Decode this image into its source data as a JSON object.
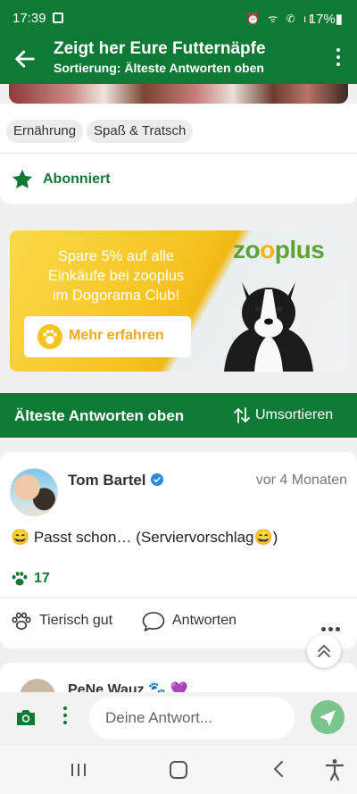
{
  "status_bar": {
    "time": "17:39",
    "icons": "⏰ ᯤ ✆ ıl",
    "battery": "17%▮"
  },
  "app_bar": {
    "title": "Zeigt her Eure Futternäpfe",
    "subtitle": "Sortierung: Älteste Antworten oben"
  },
  "tags": [
    "Ernährung",
    "Spaß & Tratsch"
  ],
  "subscribe": {
    "label": "Abonniert"
  },
  "ad": {
    "lines": [
      "Spare 5% auf alle",
      "Einkäufe bei zooplus",
      "im Dogorama Club!"
    ],
    "button": "Mehr erfahren",
    "logo_a": "zo",
    "logo_b": "plus"
  },
  "sort_bar": {
    "title": "Älteste Antworten oben",
    "action": "Umsortieren"
  },
  "post": {
    "author": "Tom Bartel",
    "time": "vor 4 Monaten",
    "text": "😄 Passt schon… (Serviervorschlag😄)",
    "paw_count": "17",
    "like_label": "Tierisch gut",
    "reply_label": "Antworten"
  },
  "next_post": {
    "author": "PeNe Wauz 🐾 💜"
  },
  "composer": {
    "placeholder": "Deine Antwort..."
  },
  "colors": {
    "brand": "#0f7a36",
    "ad_yellow": "#f6c322",
    "send": "#7ac58e"
  }
}
